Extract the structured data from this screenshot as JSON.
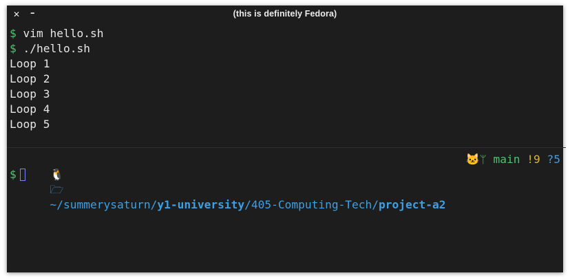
{
  "window": {
    "title": "(this is definitely Fedora)",
    "close_label": "✕",
    "minimize_label": "–"
  },
  "terminal": {
    "prompt_symbol": "$",
    "commands": [
      {
        "text": " vim hello.sh"
      },
      {
        "text": " ./hello.sh"
      }
    ],
    "output": [
      "Loop 1",
      "Loop 2",
      "Loop 3",
      "Loop 4",
      "Loop 5"
    ],
    "prompt": {
      "os_icon": "linux-tux-icon",
      "os_glyph": "🐧",
      "folder_icon": "folder-open-icon",
      "folder_glyph": "🗁",
      "path_prefix": "~/summerysaturn/",
      "path_bold_1": "y1-university",
      "path_mid": "/405-Computing-Tech/",
      "path_bold_2": "project-a2",
      "git_icon": "github-icon",
      "git_glyph": "🐱",
      "branch_icon": "git-branch-icon",
      "branch_glyph": "ᛘ",
      "branch": "main",
      "modified": "!9",
      "untracked": "?5"
    }
  },
  "colors": {
    "background": "#1d1d1d",
    "prompt_green": "#4ec26e",
    "path_blue": "#3ea0e4",
    "modified_yellow": "#d7b43a",
    "cursor_purple": "#7b83ff"
  }
}
